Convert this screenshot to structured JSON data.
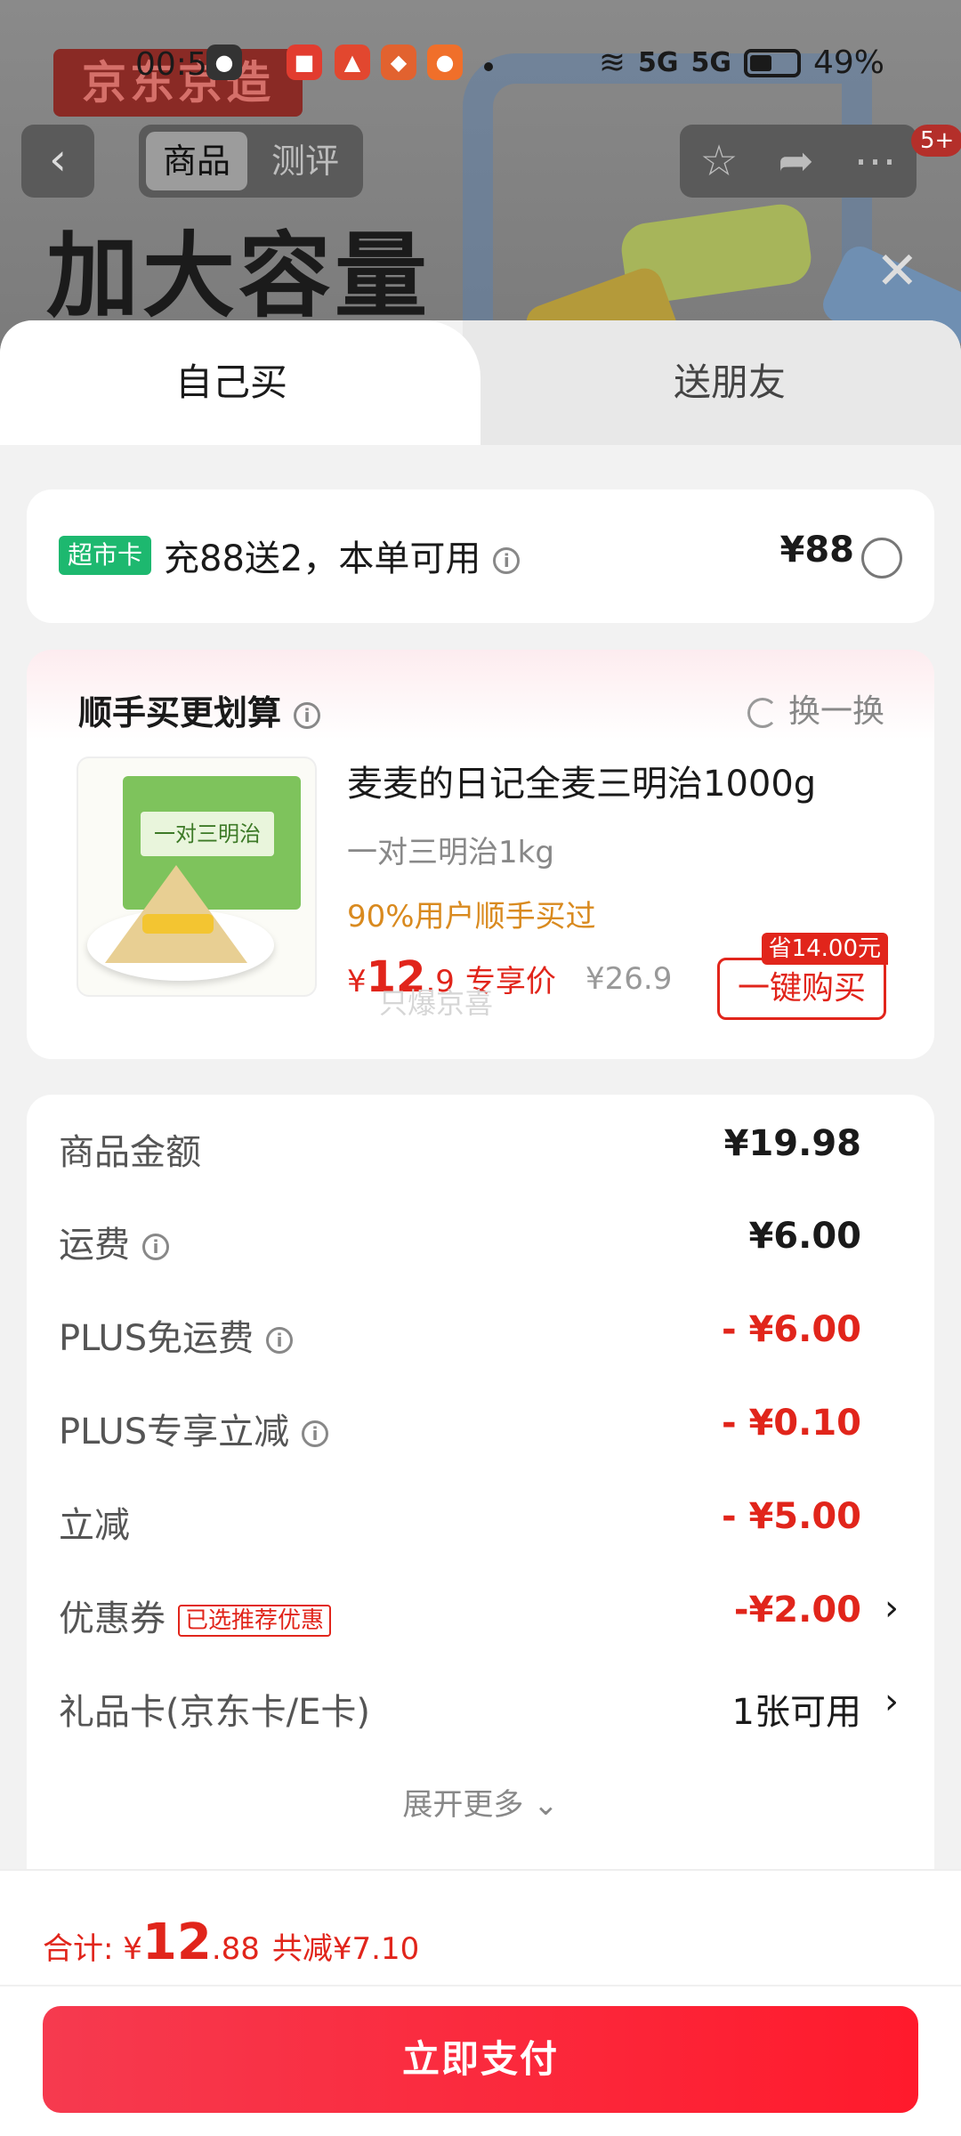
{
  "status_bar": {
    "time": "00:53",
    "battery": "49%",
    "signal1": "5G",
    "signal2": "5G"
  },
  "background_page": {
    "brand": "京东京造",
    "hero_title": "加大容量",
    "tabs": [
      "商品",
      "测评"
    ],
    "message_badge": "5+"
  },
  "sheet": {
    "tabs": {
      "self": "自己买",
      "gift": "送朋友"
    },
    "supermarket": {
      "tag": "超市卡",
      "text": "充88送2，本单可用",
      "price": "¥88"
    },
    "bundle": {
      "title": "顺手买更划算",
      "swap_label": "换一换",
      "product": {
        "name": "麦麦的日记全麦三明治1000g",
        "spec": "一对三明治1kg",
        "rate": "90%用户顺手买过",
        "price_symbol": "¥",
        "price_int": "12",
        "price_dec": ".9",
        "price_note": "专享价",
        "orig_price": "¥26.9",
        "save_badge": "省14.00元",
        "buy_label": "一键购买",
        "watermark": "只爆京喜",
        "image_label": "一对三明治"
      }
    },
    "details": {
      "rows": [
        {
          "label": "商品金额",
          "value": "¥19.98"
        },
        {
          "label": "运费",
          "value": "¥6.00"
        },
        {
          "label": "PLUS免运费",
          "value": "- ¥6.00"
        },
        {
          "label": "PLUS专享立减",
          "value": "- ¥0.10"
        },
        {
          "label": "立减",
          "value": "- ¥5.00"
        },
        {
          "label": "优惠券",
          "tag": "已选推荐优惠",
          "value": "-¥2.00"
        },
        {
          "label": "礼品卡(京东卡/E卡)",
          "value": "1张可用"
        }
      ],
      "expand_label": "展开更多"
    },
    "bottom": {
      "total_label": "合计: ¥",
      "total_int": "12",
      "total_dec": ".88",
      "saved": "共减¥7.10",
      "pay_label": "立即支付"
    }
  },
  "colors": {
    "accent_red": "#e1251b",
    "green_tag": "#1db86f",
    "orange_rate": "#d98a1f"
  }
}
